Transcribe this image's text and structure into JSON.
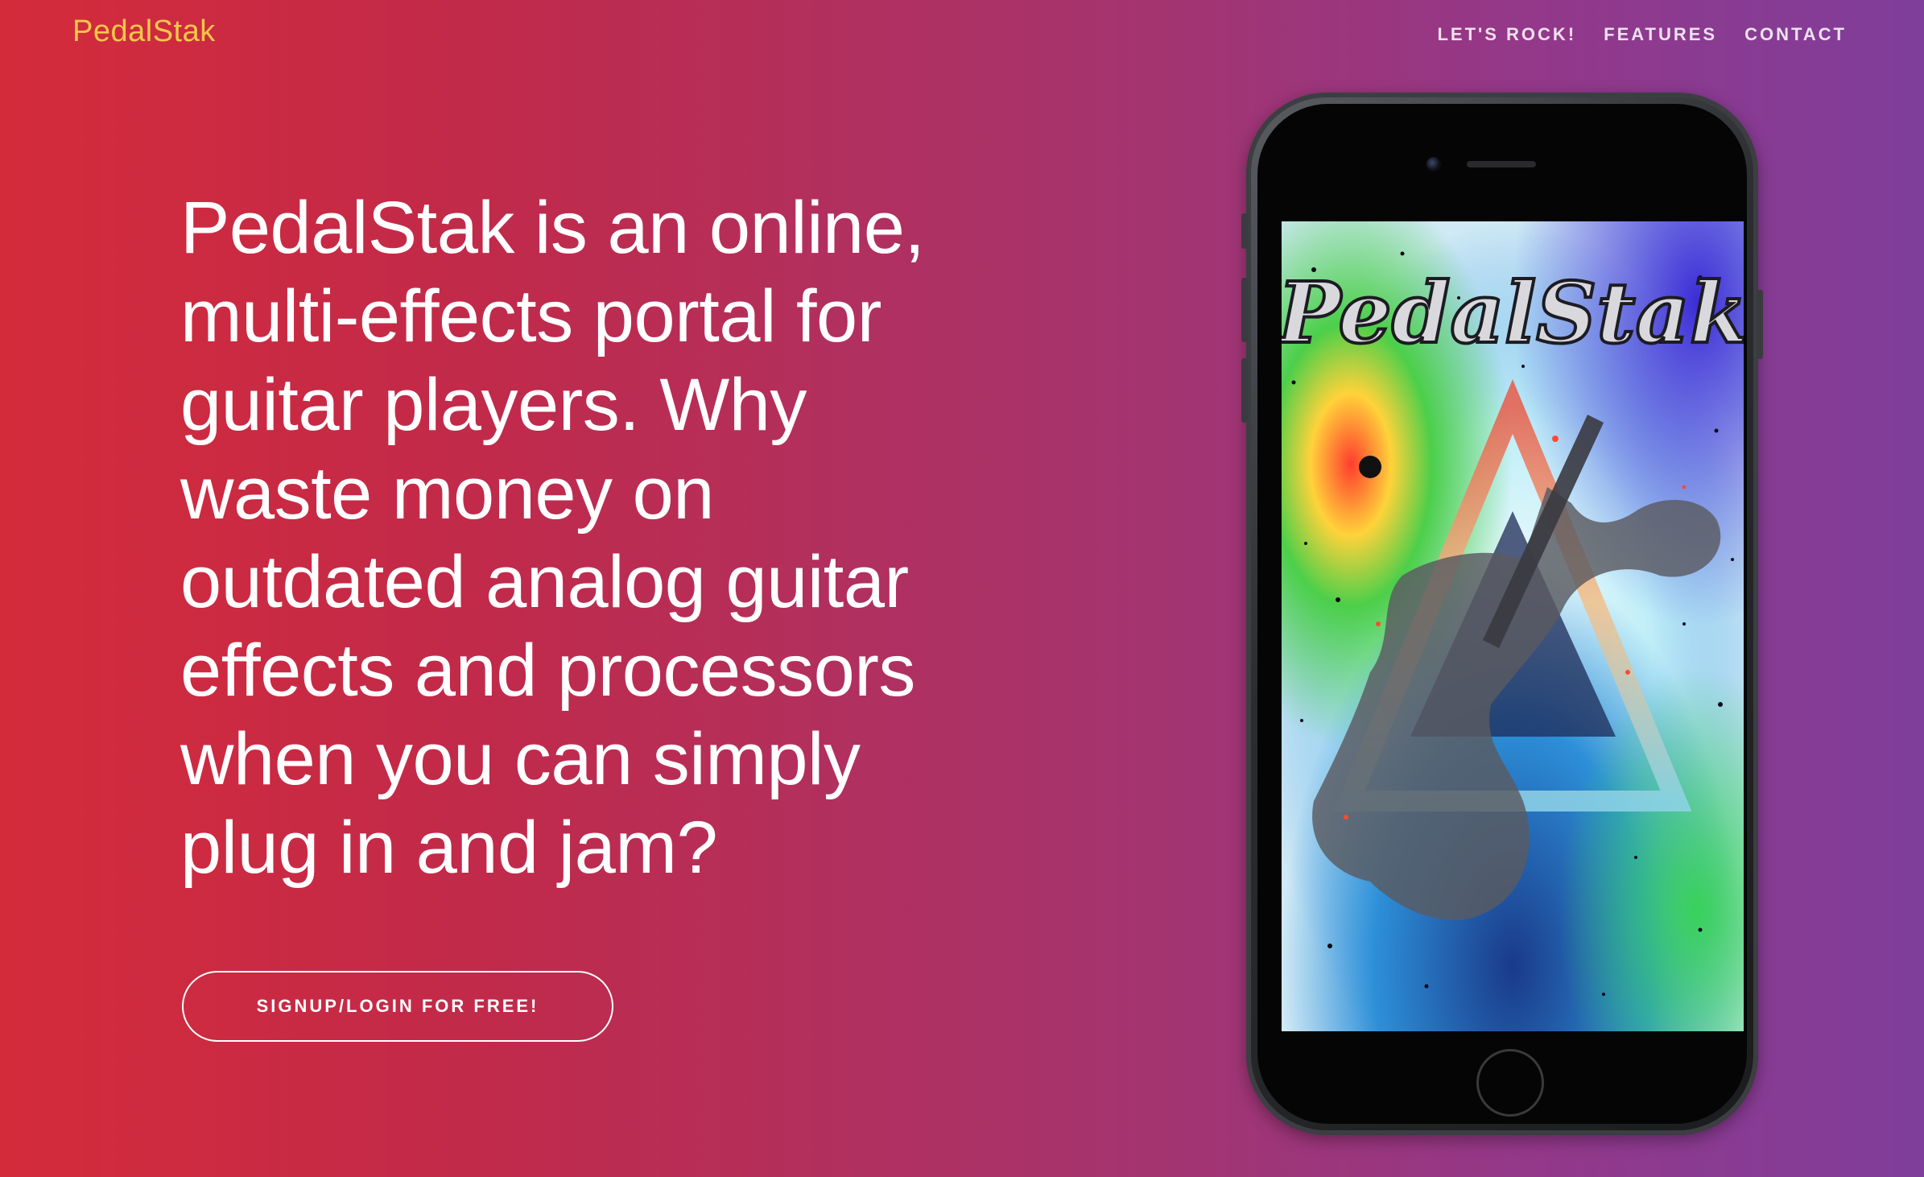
{
  "header": {
    "brand": "PedalStak",
    "nav": [
      {
        "label": "LET'S ROCK!"
      },
      {
        "label": "FEATURES"
      },
      {
        "label": "CONTACT"
      }
    ]
  },
  "hero": {
    "headline": "PedalStak is an online, multi-effects portal for guitar players. Why waste money on outdated analog guitar effects and processors when you can simply plug in and jam?",
    "cta_label": "SIGNUP/LOGIN FOR FREE!"
  },
  "phone_screen": {
    "logo_text": "PedalStak"
  },
  "colors": {
    "brand": "#f7c74a",
    "gradient_left": "#d42b3a",
    "gradient_right": "#7f3e9b"
  }
}
